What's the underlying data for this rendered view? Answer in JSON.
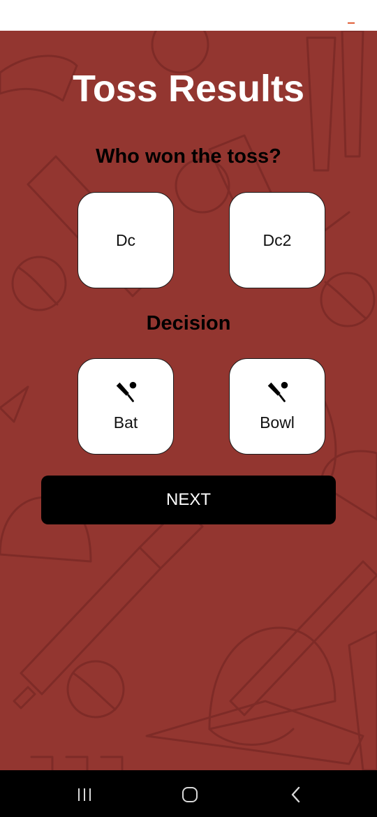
{
  "app": {
    "title": "Toss Results",
    "toss_question": "Who won the toss?",
    "decision_heading": "Decision"
  },
  "teams": [
    {
      "label": "Dc"
    },
    {
      "label": "Dc2"
    }
  ],
  "decisions": [
    {
      "label": "Bat",
      "icon": "cricket-bat-icon"
    },
    {
      "label": "Bowl",
      "icon": "cricket-bat-icon"
    }
  ],
  "next_button": {
    "label": "NEXT"
  },
  "nav": {
    "recent_icon": "recent-apps-icon",
    "home_icon": "home-icon",
    "back_icon": "back-icon"
  },
  "colors": {
    "background": "#933630",
    "card": "#ffffff",
    "button": "#000000"
  }
}
